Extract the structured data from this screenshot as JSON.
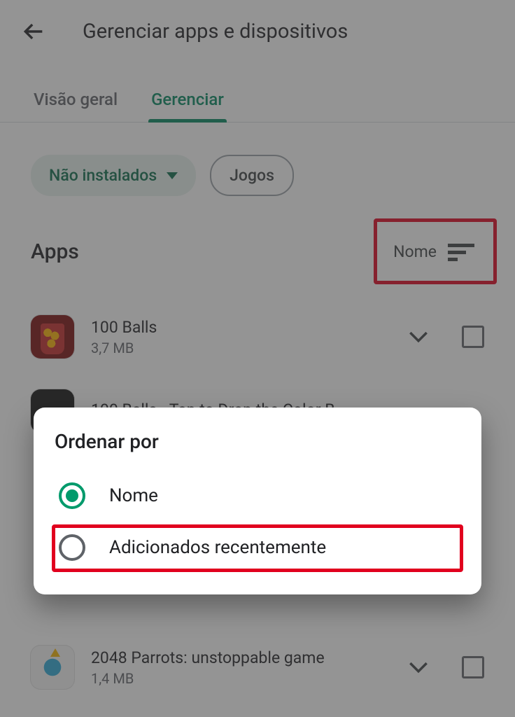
{
  "header": {
    "title": "Gerenciar apps e dispositivos"
  },
  "tabs": [
    {
      "label": "Visão geral",
      "active": false
    },
    {
      "label": "Gerenciar",
      "active": true
    }
  ],
  "chips": {
    "filter_label": "Não instalados",
    "games_label": "Jogos"
  },
  "section": {
    "title": "Apps",
    "sort_label": "Nome"
  },
  "apps": [
    {
      "name": "100 Balls",
      "size": "3,7 MB"
    },
    {
      "name": "100 Balls - Tap to Drop the Color B",
      "size": ""
    },
    {
      "name": "2048 Parrots: unstoppable game",
      "size": "1,4 MB"
    }
  ],
  "dialog": {
    "title": "Ordenar por",
    "options": [
      {
        "label": "Nome",
        "selected": true
      },
      {
        "label": "Adicionados recentemente",
        "selected": false
      }
    ]
  }
}
